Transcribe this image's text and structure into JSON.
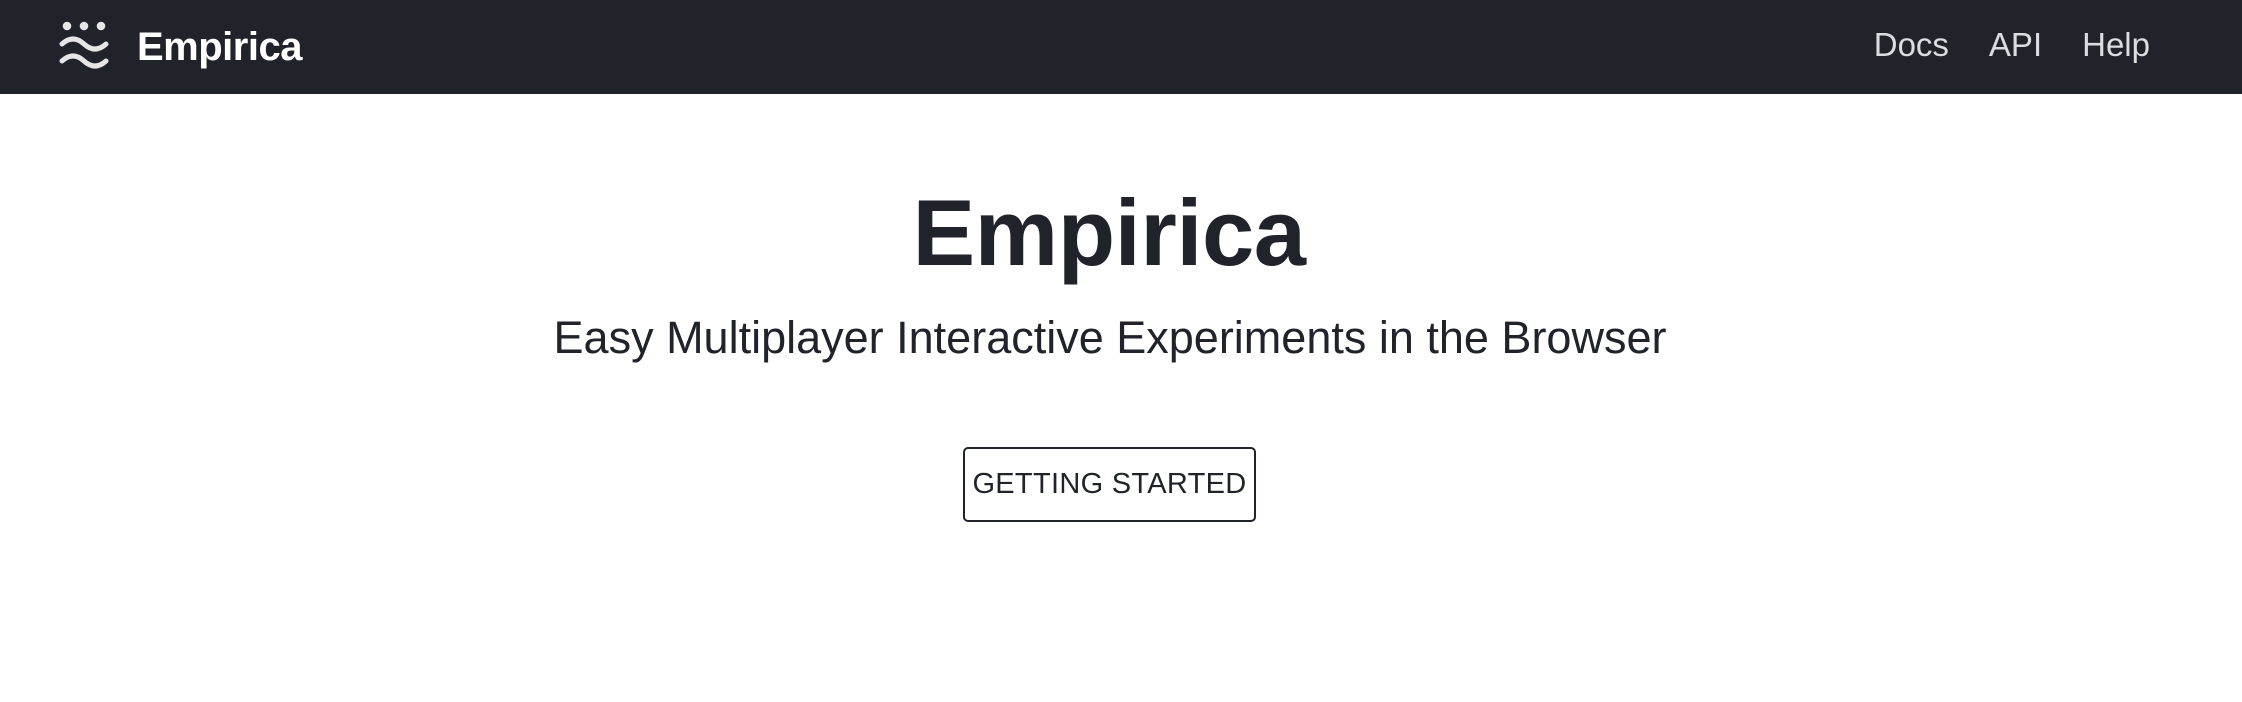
{
  "navbar": {
    "brand": {
      "name": "Empirica",
      "icon": "empirica-logo-icon"
    },
    "links": [
      {
        "label": "Docs"
      },
      {
        "label": "API"
      },
      {
        "label": "Help"
      }
    ]
  },
  "hero": {
    "title": "Empirica",
    "subtitle": "Easy Multiplayer Interactive Experiments in the Browser",
    "cta_label": "GETTING STARTED"
  },
  "colors": {
    "navbar_background": "#20232a",
    "text_primary": "#20232a",
    "nav_link": "#dcdde0",
    "page_background": "#ffffff"
  }
}
